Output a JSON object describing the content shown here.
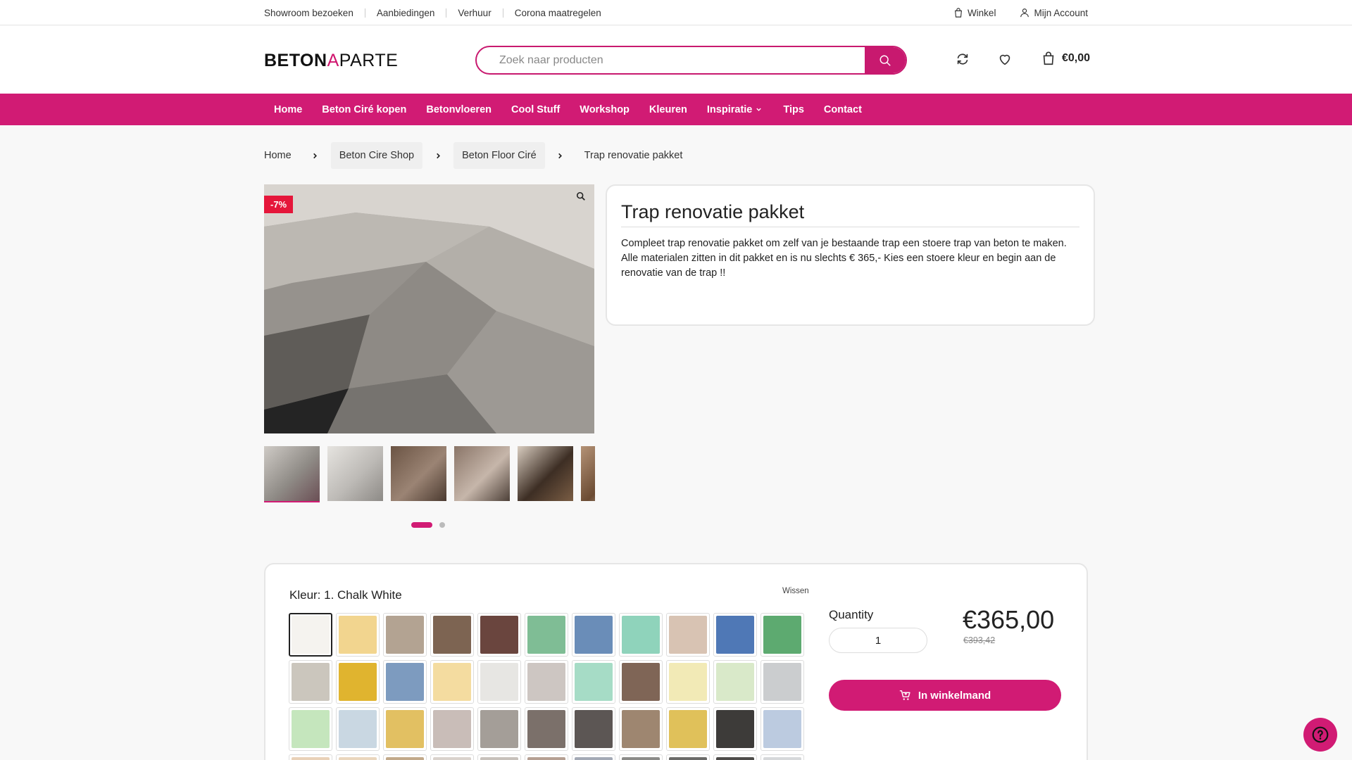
{
  "topbar": {
    "links": [
      "Showroom bezoeken",
      "Aanbiedingen",
      "Verhuur",
      "Corona maatregelen"
    ],
    "winkel": "Winkel",
    "account": "Mijn Account"
  },
  "header": {
    "logo_bold": "BETON",
    "logo_accent": "A",
    "logo_rest": "PARTE",
    "search_placeholder": "Zoek naar producten",
    "cart_total": "€0,00"
  },
  "nav": {
    "items": [
      "Home",
      "Beton Ciré kopen",
      "Betonvloeren",
      "Cool Stuff",
      "Workshop",
      "Kleuren",
      "Inspiratie",
      "Tips",
      "Contact"
    ]
  },
  "breadcrumb": [
    "Home",
    "Beton Cire Shop",
    "Beton Floor Ciré",
    "Trap renovatie pakket"
  ],
  "gallery": {
    "badge": "-7%",
    "thumbs": [
      {
        "colors": [
          "#cfcbc6",
          "#8f8b86",
          "#6b4f55"
        ]
      },
      {
        "colors": [
          "#e6e4e0",
          "#bdbab6",
          "#8d8a86"
        ]
      },
      {
        "colors": [
          "#6b5444",
          "#9b8474",
          "#4b3a30"
        ]
      },
      {
        "colors": [
          "#8a7568",
          "#c6b6aa",
          "#4d4038"
        ]
      },
      {
        "colors": [
          "#d8ccbf",
          "#3d2e24",
          "#7a5d44"
        ]
      },
      {
        "colors": [
          "#b49276",
          "#6b4b33",
          "#e3d7c9"
        ]
      }
    ]
  },
  "product": {
    "title": "Trap renovatie pakket",
    "description": "Compleet trap renovatie pakket om zelf van je bestaande trap een stoere trap van beton te maken. Alle materialen zitten in dit pakket en is nu slechts € 365,- Kies een stoere kleur en begin aan de renovatie van de trap !!"
  },
  "options": {
    "kleur_label": "Kleur: 1. Chalk White",
    "wissen": "Wissen",
    "quantity_label": "Quantity",
    "quantity_value": "1",
    "price": "€365,00",
    "old_price": "€393,42",
    "add_to_cart": "In winkelmand",
    "swatches": [
      "#f5f3ef",
      "#f2d58f",
      "#b3a392",
      "#7d6452",
      "#6a453e",
      "#7fbd95",
      "#6a8db8",
      "#8fd3bb",
      "#d8c3b3",
      "#4f78b6",
      "#5daa70",
      "#cbc6bd",
      "#e0b42f",
      "#7d9bbf",
      "#f4dca0",
      "#e7e6e3",
      "#cdc6c2",
      "#a6dcc6",
      "#7f6556",
      "#f2eab6",
      "#d9e9c9",
      "#cbcdcf",
      "#c5e6bd",
      "#c9d7e2",
      "#e2c062",
      "#c9bdb8",
      "#a49e98",
      "#7b706a",
      "#5c5654",
      "#9e8670",
      "#e0c15a",
      "#3d3b39",
      "#bccbe0",
      "#e9d1b8",
      "#ead6bd",
      "#c2a98a",
      "#d9d2cc",
      "#c7c1bb",
      "#b59f92",
      "#a3a9b5",
      "#8b8b88",
      "#6b6b69",
      "#4e4c4a",
      "#d6d8da"
    ]
  }
}
